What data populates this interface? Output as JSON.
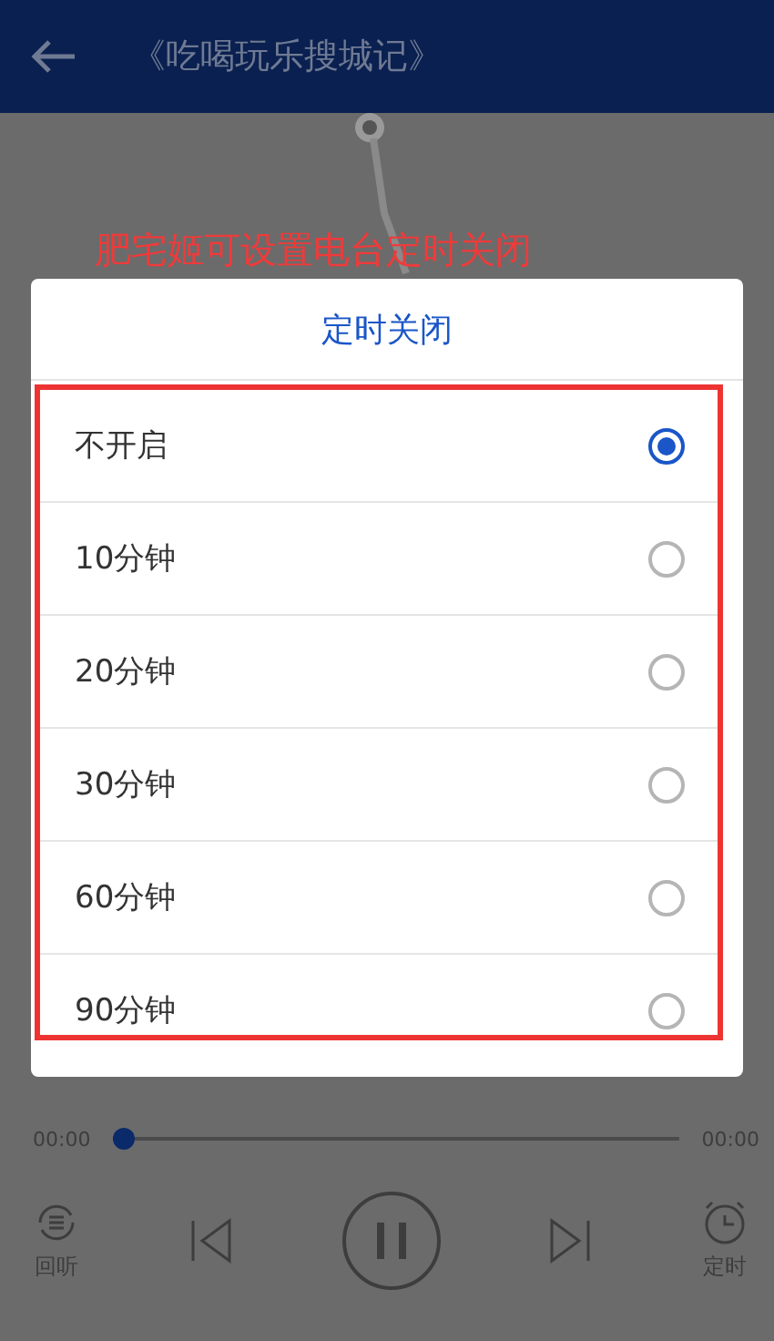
{
  "app_bar": {
    "title": "《吃喝玩乐搜城记》"
  },
  "annotation": "肥宅姬可设置电台定时关闭",
  "dialog": {
    "title": "定时关闭",
    "options": [
      {
        "label": "不开启",
        "selected": true
      },
      {
        "label": "10分钟",
        "selected": false
      },
      {
        "label": "20分钟",
        "selected": false
      },
      {
        "label": "30分钟",
        "selected": false
      },
      {
        "label": "60分钟",
        "selected": false
      },
      {
        "label": "90分钟",
        "selected": false
      }
    ]
  },
  "player": {
    "elapsed": "00:00",
    "duration": "00:00",
    "level": 0,
    "controls": [
      {
        "kind": "replay",
        "label": "回听"
      },
      {
        "kind": "previous"
      },
      {
        "kind": "play_pause"
      },
      {
        "kind": "next"
      },
      {
        "kind": "timer",
        "label": "定时"
      }
    ]
  }
}
